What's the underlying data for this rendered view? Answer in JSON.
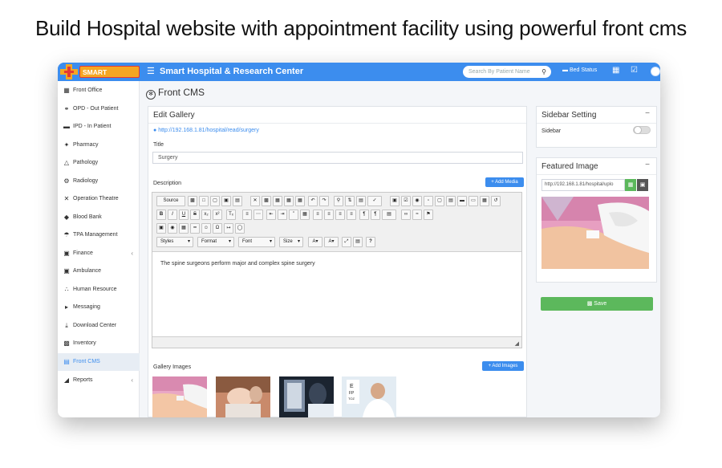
{
  "headline": "Build Hospital website with appointment facility using powerful front cms",
  "topbar": {
    "brand": "SMART HOSPITAL",
    "app_title": "Smart Hospital & Research Center",
    "search_placeholder": "Search By Patient Name",
    "bed_status": "Bed Status"
  },
  "sidebar": {
    "items": [
      {
        "label": "Front Office",
        "icon": "building-icon"
      },
      {
        "label": "OPD - Out Patient",
        "icon": "stethoscope-icon"
      },
      {
        "label": "IPD - In Patient",
        "icon": "bed-icon"
      },
      {
        "label": "Pharmacy",
        "icon": "pill-icon"
      },
      {
        "label": "Pathology",
        "icon": "flask-icon"
      },
      {
        "label": "Radiology",
        "icon": "microscope-icon"
      },
      {
        "label": "Operation Theatre",
        "icon": "scissors-icon"
      },
      {
        "label": "Blood Bank",
        "icon": "droplet-icon"
      },
      {
        "label": "TPA Management",
        "icon": "umbrella-icon"
      },
      {
        "label": "Finance",
        "icon": "money-icon"
      },
      {
        "label": "Ambulance",
        "icon": "ambulance-icon"
      },
      {
        "label": "Human Resource",
        "icon": "sitemap-icon"
      },
      {
        "label": "Messaging",
        "icon": "bullhorn-icon"
      },
      {
        "label": "Download Center",
        "icon": "download-icon"
      },
      {
        "label": "Inventory",
        "icon": "boxes-icon"
      },
      {
        "label": "Front CMS",
        "icon": "cms-icon"
      },
      {
        "label": "Reports",
        "icon": "chart-icon"
      }
    ],
    "active": "Front CMS"
  },
  "page": {
    "title": "Front CMS"
  },
  "edit_gallery": {
    "heading": "Edit Gallery",
    "url": "http://192.168.1.81/hospital/read/surgery",
    "title_label": "Title",
    "title_value": "Surgery",
    "description_label": "Description",
    "add_media": "+ Add Media",
    "editor_content": "The spine surgeons perform major and complex spine surgery",
    "toolbar": {
      "source": "Source",
      "styles": "Styles",
      "format": "Format",
      "font": "Font",
      "size": "Size"
    },
    "gallery_label": "Gallery Images",
    "add_images": "+ Add Images"
  },
  "sidebar_setting": {
    "heading": "Sidebar Setting",
    "toggle_label": "Sidebar",
    "minus": "−"
  },
  "featured_image": {
    "heading": "Featured Image",
    "url_value": "http://192.168.1.81/hospital/uplo",
    "minus": "−"
  },
  "save_label": "Save",
  "colors": {
    "topbar": "#3c8dee",
    "save": "#5cb85c",
    "brand_bg": "#f5a623"
  }
}
